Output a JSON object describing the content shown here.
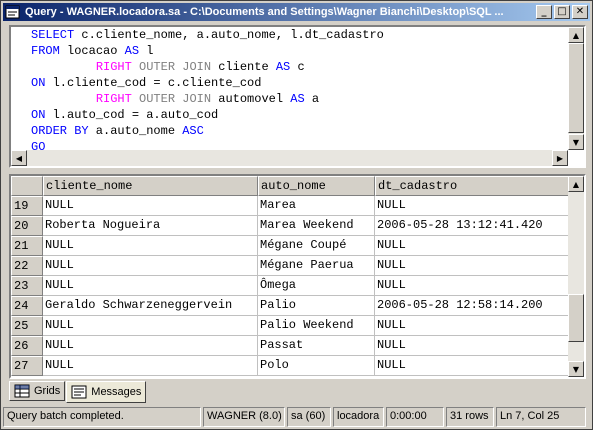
{
  "window": {
    "title": "Query - WAGNER.locadora.sa - C:\\Documents and Settings\\Wagner Bianchi\\Desktop\\SQL ...",
    "minimize_glyph": "_",
    "maximize_glyph": "□",
    "close_glyph": "✕"
  },
  "editor": {
    "lines": [
      [
        {
          "t": "SELECT",
          "c": "kw"
        },
        {
          "t": " c.cliente_nome, a.auto_nome, l.dt_cadastro",
          "c": ""
        }
      ],
      [
        {
          "t": "FROM",
          "c": "kw"
        },
        {
          "t": " locacao ",
          "c": ""
        },
        {
          "t": "AS",
          "c": "kw"
        },
        {
          "t": " l",
          "c": ""
        }
      ],
      [
        {
          "t": "         ",
          "c": ""
        },
        {
          "t": "RIGHT",
          "c": "kwm"
        },
        {
          "t": " OUTER JOIN",
          "c": "kwg"
        },
        {
          "t": " cliente ",
          "c": ""
        },
        {
          "t": "AS",
          "c": "kw"
        },
        {
          "t": " c",
          "c": ""
        }
      ],
      [
        {
          "t": "ON",
          "c": "kw"
        },
        {
          "t": " l.cliente_cod = c.cliente_cod",
          "c": ""
        }
      ],
      [
        {
          "t": "         ",
          "c": ""
        },
        {
          "t": "RIGHT",
          "c": "kwm"
        },
        {
          "t": " OUTER JOIN",
          "c": "kwg"
        },
        {
          "t": " automovel ",
          "c": ""
        },
        {
          "t": "AS",
          "c": "kw"
        },
        {
          "t": " a",
          "c": ""
        }
      ],
      [
        {
          "t": "ON",
          "c": "kw"
        },
        {
          "t": " l.auto_cod = a.auto_cod",
          "c": ""
        }
      ],
      [
        {
          "t": "ORDER BY",
          "c": "kw"
        },
        {
          "t": " a.auto_nome ",
          "c": ""
        },
        {
          "t": "ASC",
          "c": "kw"
        }
      ],
      [
        {
          "t": "GO",
          "c": "kw"
        }
      ]
    ]
  },
  "grid": {
    "columns": [
      "cliente_nome",
      "auto_nome",
      "dt_cadastro"
    ],
    "rows": [
      [
        "19",
        "NULL",
        "Marea",
        "NULL"
      ],
      [
        "20",
        "Roberta Nogueira",
        "Marea Weekend",
        "2006-05-28 13:12:41.420"
      ],
      [
        "21",
        "NULL",
        "Mégane Coupé",
        "NULL"
      ],
      [
        "22",
        "NULL",
        "Mégane Paerua",
        "NULL"
      ],
      [
        "23",
        "NULL",
        "Ômega",
        "NULL"
      ],
      [
        "24",
        "Geraldo Schwarzeneggervein",
        "Palio",
        "2006-05-28 12:58:14.200"
      ],
      [
        "25",
        "NULL",
        "Palio Weekend",
        "NULL"
      ],
      [
        "26",
        "NULL",
        "Passat",
        "NULL"
      ],
      [
        "27",
        "NULL",
        "Polo",
        "NULL"
      ]
    ]
  },
  "tabs": [
    {
      "label": "Grids",
      "icon": "grid-icon",
      "active": false
    },
    {
      "label": "Messages",
      "icon": "messages-icon",
      "active": true
    }
  ],
  "status": {
    "message": "Query batch completed.",
    "server": "WAGNER (8.0)",
    "user": "sa (60)",
    "database": "locadora",
    "elapsed": "0:00:00",
    "rows": "31 rows",
    "position": "Ln 7, Col 25"
  },
  "colors": {
    "keyword": "#0000ff",
    "join": "#808080",
    "right": "#ff00ff",
    "title_start": "#0a246a",
    "title_end": "#a6caf0"
  }
}
